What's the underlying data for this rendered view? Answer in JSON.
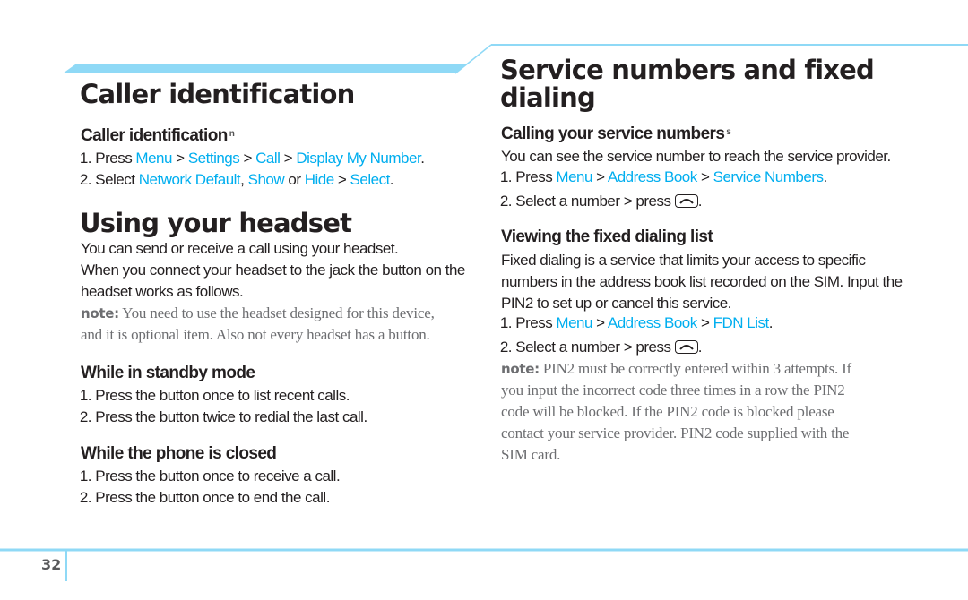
{
  "page": {
    "number": "32",
    "accent_color": "#00aeef",
    "rule_color": "#8fd9f6"
  },
  "left": {
    "caller_id": {
      "title": "Caller identification",
      "subtitle": "Caller identification",
      "subtitle_mark": "n",
      "steps": [
        {
          "num": "1.",
          "parts": [
            {
              "t": "Press ",
              "link": false
            },
            {
              "t": "Menu",
              "link": true
            },
            {
              "t": " > ",
              "link": false
            },
            {
              "t": "Settings",
              "link": true
            },
            {
              "t": " > ",
              "link": false
            },
            {
              "t": "Call",
              "link": true
            },
            {
              "t": " > ",
              "link": false
            },
            {
              "t": "Display My Number",
              "link": true
            },
            {
              "t": ".",
              "link": false
            }
          ]
        },
        {
          "num": "2.",
          "parts": [
            {
              "t": "Select ",
              "link": false
            },
            {
              "t": "Network Default",
              "link": true
            },
            {
              "t": ", ",
              "link": false
            },
            {
              "t": "Show",
              "link": true
            },
            {
              "t": " or ",
              "link": false
            },
            {
              "t": "Hide",
              "link": true
            },
            {
              "t": " > ",
              "link": false
            },
            {
              "t": "Select",
              "link": true
            },
            {
              "t": ".",
              "link": false
            }
          ]
        }
      ]
    },
    "headset": {
      "title": "Using your headset",
      "para1": "You can send or receive a call using your headset.",
      "para2_line1": "When you connect your headset to the jack the button on the",
      "para2_line2": "headset works as follows.",
      "note_label": "note:",
      "note_line1": " You need to use the headset designed for this device,",
      "note_line2": "and it is optional item. Also not every headset has a button.",
      "standby": {
        "title": "While in standby mode",
        "steps": [
          {
            "num": "1.",
            "text": "Press the button once to list recent calls."
          },
          {
            "num": "2.",
            "text": "Press the button twice to redial the last call."
          }
        ]
      },
      "closed": {
        "title": "While the phone is closed",
        "steps": [
          {
            "num": "1.",
            "text": "Press the button once to receive a call."
          },
          {
            "num": "2.",
            "text": "Press the button once to end the call."
          }
        ]
      }
    }
  },
  "right": {
    "title_line1": "Service numbers and fixed",
    "title_line2": "dialing",
    "service": {
      "subtitle": "Calling your service numbers",
      "subtitle_mark": "s",
      "intro": "You can see the service number to reach the service provider.",
      "steps": [
        {
          "num": "1.",
          "parts": [
            {
              "t": "Press ",
              "link": false
            },
            {
              "t": "Menu",
              "link": true
            },
            {
              "t": " > ",
              "link": false
            },
            {
              "t": "Address Book",
              "link": true
            },
            {
              "t": " > ",
              "link": false
            },
            {
              "t": "Service Numbers",
              "link": true
            },
            {
              "t": ".",
              "link": false
            }
          ]
        }
      ],
      "step2_num": "2.",
      "step2_text": "Select a number > press",
      "step2_icon": "end-call-key-icon",
      "step2_end": "."
    },
    "fdn": {
      "subtitle": "Viewing the fixed dialing list",
      "intro_line1": "Fixed dialing is a service that limits your access to specific",
      "intro_line2": "numbers in the address book list recorded on the SIM. Input the",
      "intro_line3": "PIN2 to set up or cancel this service.",
      "steps": [
        {
          "num": "1.",
          "parts": [
            {
              "t": "Press ",
              "link": false
            },
            {
              "t": "Menu",
              "link": true
            },
            {
              "t": " > ",
              "link": false
            },
            {
              "t": "Address Book",
              "link": true
            },
            {
              "t": " > ",
              "link": false
            },
            {
              "t": "FDN List",
              "link": true
            },
            {
              "t": ".",
              "link": false
            }
          ]
        }
      ],
      "step2_num": "2.",
      "step2_text": "Select a number > press",
      "step2_icon": "end-call-key-icon",
      "step2_end": ".",
      "note_label": "note:",
      "note_line1": " PIN2 must be correctly entered within 3 attempts. If",
      "note_line2": "you input the incorrect code three times in a row the PIN2",
      "note_line3": "code will be blocked. If the PIN2 code is blocked please",
      "note_line4": "contact your service provider. PIN2 code supplied with the",
      "note_line5": "SIM card."
    }
  }
}
